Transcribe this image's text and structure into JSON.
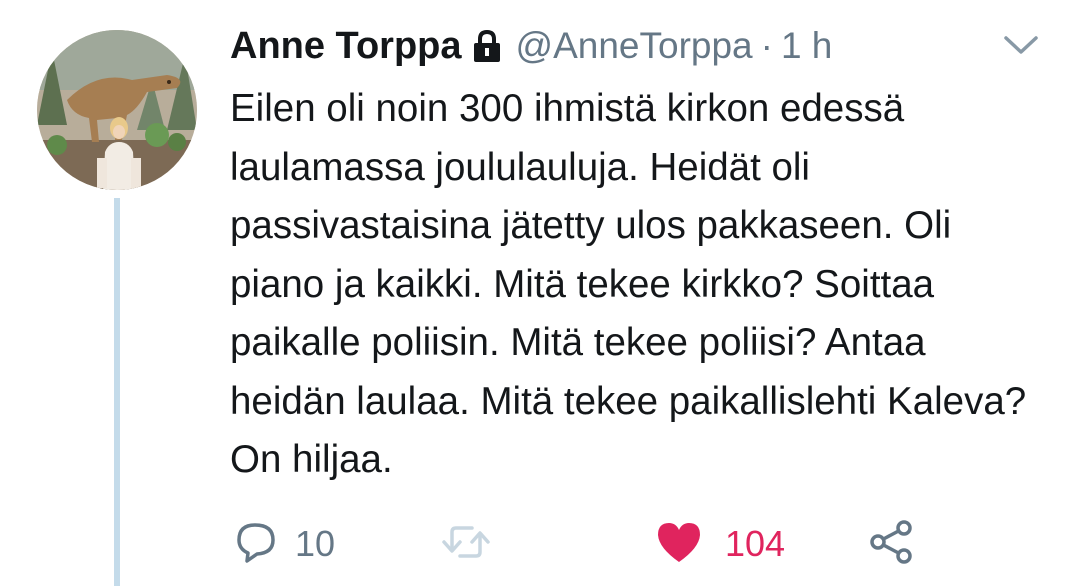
{
  "tweet": {
    "display_name": "Anne Torppa",
    "handle": "@AnneTorppa",
    "separator": "·",
    "time": "1 h",
    "text": "Eilen oli noin 300 ihmistä kirkon edessä laulamassa joululauluja. Heidät oli passivastaisina jätetty ulos pakkaseen. Oli piano ja kaikki. Mitä tekee kirkko? Soittaa paikalle poliisin. Mitä tekee poliisi? Antaa heidän laulaa. Mitä tekee paikallislehti Kaleva? On hiljaa.",
    "protected_icon": "lock-icon",
    "menu_icon": "chevron-down-icon"
  },
  "actions": {
    "reply": {
      "icon": "reply-icon",
      "count": "10"
    },
    "retweet": {
      "icon": "retweet-icon",
      "count": ""
    },
    "like": {
      "icon": "heart-icon",
      "count": "104",
      "liked": true
    },
    "share": {
      "icon": "share-icon"
    }
  },
  "colors": {
    "text": "#14171a",
    "secondary": "#657786",
    "like": "#e0245e",
    "thread_line": "#c4dbea",
    "retweet_disabled": "#c8d6e0"
  }
}
